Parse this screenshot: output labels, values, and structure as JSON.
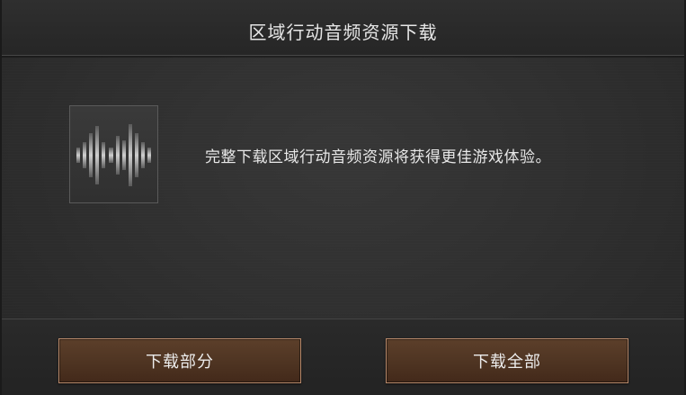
{
  "dialog": {
    "title": "区域行动音频资源下载",
    "icon": "audio-waveform-icon",
    "message": "完整下载区域行动音频资源将获得更佳游戏体验。",
    "buttons": {
      "download_partial": "下载部分",
      "download_all": "下载全部"
    }
  },
  "colors": {
    "background": "#2e2e2e",
    "button_fill": "#4e3422",
    "button_border": "#b8896a",
    "text": "#e6e6e6"
  }
}
